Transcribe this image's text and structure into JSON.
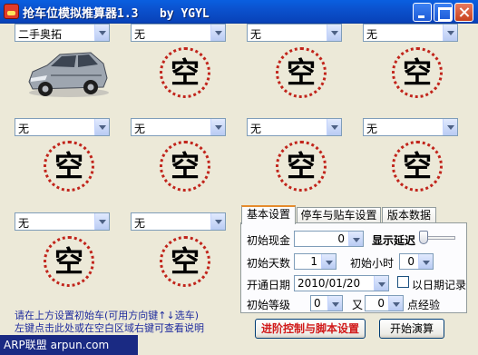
{
  "window": {
    "title": "抢车位模拟推算器1.3   by YGYL"
  },
  "slots": [
    {
      "combo": "二手奥拓",
      "content": "car-image"
    },
    {
      "combo": "无",
      "content": "空"
    },
    {
      "combo": "无",
      "content": "空"
    },
    {
      "combo": "无",
      "content": "空"
    },
    {
      "combo": "无",
      "content": "空"
    },
    {
      "combo": "无",
      "content": "空"
    },
    {
      "combo": "无",
      "content": "空"
    },
    {
      "combo": "无",
      "content": "空"
    },
    {
      "combo": "无",
      "content": "空"
    },
    {
      "combo": "无",
      "content": "空"
    }
  ],
  "instructions": {
    "line1": "请在上方设置初始车(可用方向键↑↓选车)",
    "line2": "左键点击此处或在空白区域右键可查看说明"
  },
  "brand": "ARP联盟 arpun.com",
  "tabs": [
    "基本设置",
    "停车与贴车设置",
    "版本数据"
  ],
  "settings": {
    "initial_cash_label": "初始现金",
    "initial_cash_value": "0",
    "show_delay_label": "显示延迟",
    "initial_days_label": "初始天数",
    "initial_days_value": "1",
    "initial_hours_label": "初始小时",
    "initial_hours_value": "0",
    "start_date_label": "开通日期",
    "start_date_value": "2010/01/20",
    "record_by_date_label": "以日期记录",
    "initial_level_label": "初始等级",
    "initial_level_value": "0",
    "and_label": "又",
    "exp_value": "0",
    "exp_label": "点经验"
  },
  "buttons": {
    "advanced": "进阶控制与脚本设置",
    "start": "开始演算"
  },
  "colors": {
    "titlebar": "#0B50CC",
    "circle": "#C1241B",
    "info_text": "#1F2C9E",
    "advanced_text": "#D11A1A",
    "brand_bg": "#1A2A83"
  }
}
